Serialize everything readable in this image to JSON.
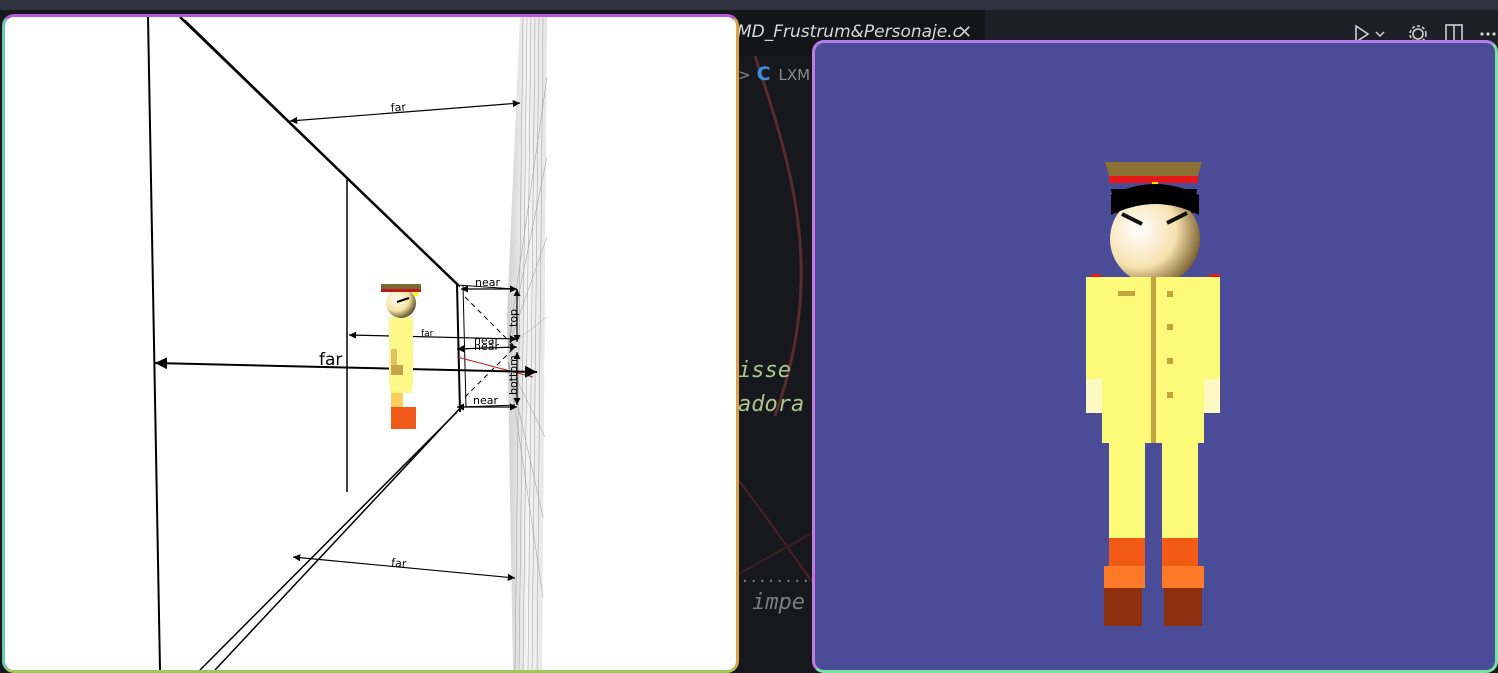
{
  "editor": {
    "tab_title": "MD_Frustrum&Personaje.c",
    "tab_close": "✕",
    "breadcrumb_sep": ">",
    "breadcrumb_icon": "C",
    "breadcrumb_text": "LXM",
    "code_line1": "isse",
    "code_line2": "adora",
    "code_line3": "impe",
    "dots": "........",
    "code_color": "#a9c78a",
    "icons": [
      "run-icon",
      "chevron-down-icon",
      "gear-icon",
      "split-editor-icon",
      "more-icon"
    ]
  },
  "frustum_window": {
    "labels": {
      "far_top": "far",
      "far_middle": "far",
      "far_small": "far",
      "far_bottom": "far",
      "near_top": "near",
      "near_mid_a": "near",
      "near_mid_b": "near",
      "near_bottom": "near",
      "top": "top",
      "bottom": "bottom"
    }
  },
  "character_window": {
    "background": "#4b4c98"
  }
}
